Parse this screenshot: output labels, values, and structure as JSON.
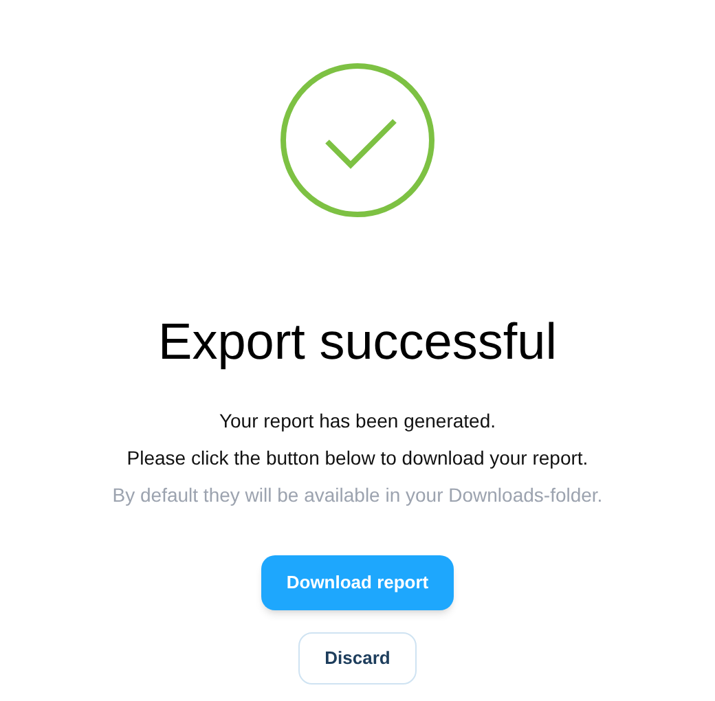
{
  "title": "Export successful",
  "messages": [
    {
      "text": "Your report has been generated.",
      "muted": false
    },
    {
      "text": "Please click the button below to download your report.",
      "muted": false
    },
    {
      "text": "By default they will be available in your Downloads-folder.",
      "muted": true
    }
  ],
  "buttons": [
    {
      "label": "Download report",
      "kind": "primary"
    },
    {
      "label": "Discard",
      "kind": "secondary"
    }
  ]
}
